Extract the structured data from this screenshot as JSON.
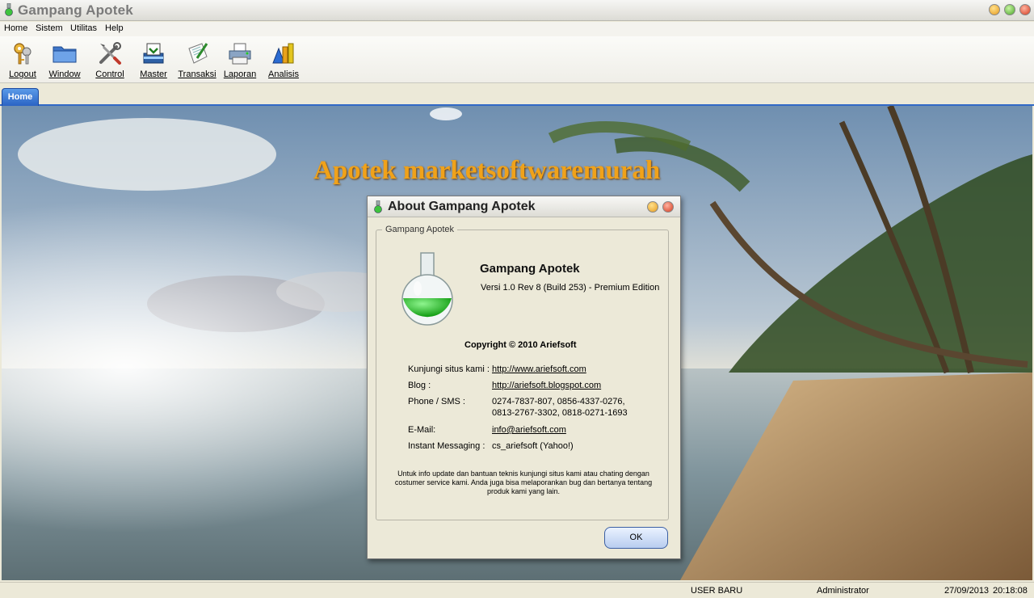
{
  "window": {
    "title": "Gampang Apotek"
  },
  "menu": [
    "Home",
    "Sistem",
    "Utilitas",
    "Help"
  ],
  "toolbar": [
    {
      "label": "Logout",
      "icon": "keys-icon"
    },
    {
      "label": "Window",
      "icon": "folder-icon"
    },
    {
      "label": "Control",
      "icon": "tools-icon"
    },
    {
      "label": "Master",
      "icon": "inbox-icon"
    },
    {
      "label": "Transaksi",
      "icon": "notepad-icon"
    },
    {
      "label": "Laporan",
      "icon": "printer-icon"
    },
    {
      "label": "Analisis",
      "icon": "chart-icon"
    }
  ],
  "tabs": [
    {
      "label": "Home"
    }
  ],
  "banner": "Apotek marketsoftwaremurah",
  "dialog": {
    "title": "About Gampang Apotek",
    "group_label": "Gampang Apotek",
    "product_name": "Gampang Apotek",
    "version": "Versi 1.0 Rev 8 (Build 253) - Premium Edition",
    "copyright": "Copyright © 2010 Ariefsoft",
    "website_label": "Kunjungi situs kami :",
    "website": "http://www.ariefsoft.com",
    "blog_label": "Blog :",
    "blog": "http://ariefsoft.blogspot.com",
    "phone_label": "Phone / SMS :",
    "phone_line1": "0274-7837-807, 0856-4337-0276,",
    "phone_line2": "0813-2767-3302, 0818-0271-1693",
    "email_label": "E-Mail:",
    "email": "info@ariefsoft.com",
    "im_label": "Instant Messaging :",
    "im": "cs_ariefsoft (Yahoo!)",
    "note": "Untuk info update dan bantuan teknis kunjungi situs kami atau chating dengan costumer service kami. Anda juga bisa melaporankan bug dan bertanya tentang produk kami yang lain.",
    "ok_label": "OK"
  },
  "status": {
    "user_status": "USER BARU",
    "role": "Administrator",
    "date": "27/09/2013",
    "time": "20:18:08"
  }
}
